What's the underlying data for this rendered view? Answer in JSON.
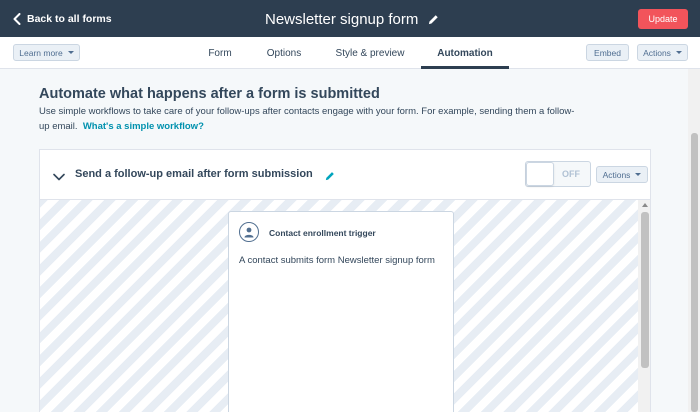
{
  "header": {
    "back_label": "Back to all forms",
    "form_title": "Newsletter signup form",
    "update_label": "Update"
  },
  "nav": {
    "learn_more_label": "Learn more",
    "tabs": [
      {
        "label": "Form",
        "active": false
      },
      {
        "label": "Options",
        "active": false
      },
      {
        "label": "Style & preview",
        "active": false
      },
      {
        "label": "Automation",
        "active": true
      }
    ],
    "embed_label": "Embed",
    "actions_label": "Actions"
  },
  "main": {
    "heading": "Automate what happens after a form is submitted",
    "description": "Use simple workflows to take care of your follow-ups after contacts engage with your form. For example, sending them a follow-up email.",
    "help_link": "What's a simple workflow?"
  },
  "workflow": {
    "title": "Send a follow-up email after form submission",
    "toggle_state": "OFF",
    "actions_label": "Actions",
    "trigger": {
      "title": "Contact enrollment trigger",
      "description": "A contact submits form Newsletter signup form"
    }
  },
  "colors": {
    "header_bg": "#2d3e50",
    "accent_orange": "#f2545b",
    "link": "#0091ae",
    "text": "#33475b"
  },
  "icons": {
    "back": "chevron-left-icon",
    "edit": "pencil-icon",
    "collapse": "chevron-down-icon",
    "contact": "person-icon"
  }
}
